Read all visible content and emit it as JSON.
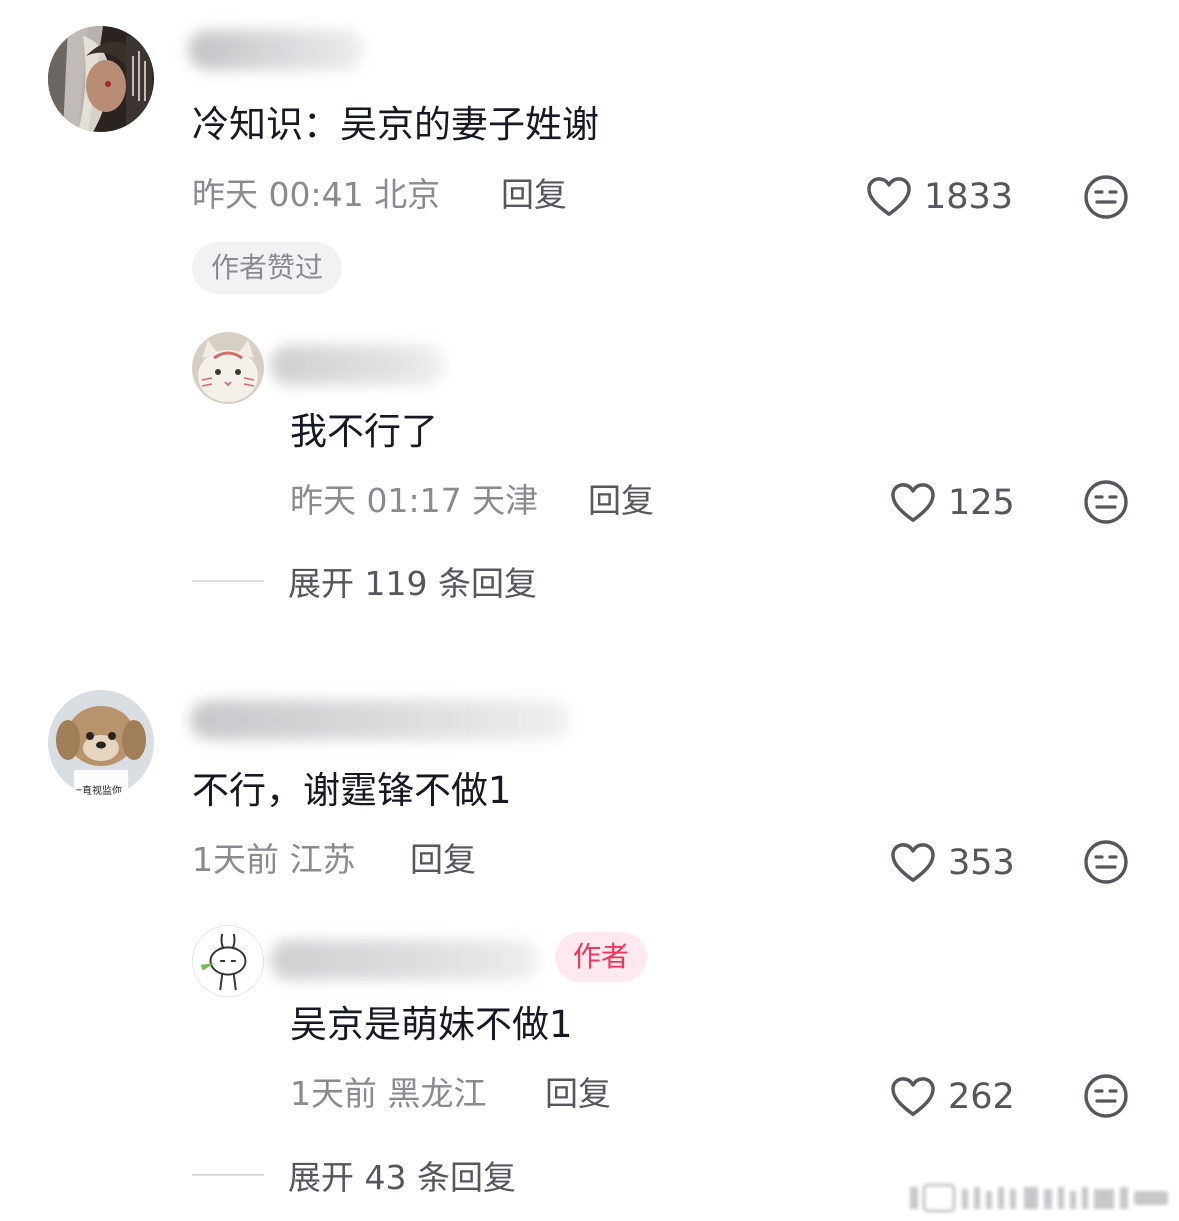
{
  "comments": [
    {
      "text": "冷知识：吴京的妻子姓谢",
      "time": "昨天 00:41",
      "location": "北京",
      "reply_label": "回复",
      "likes": "1833",
      "badge": "作者赞过",
      "avatar_icon": "dark-haired-character-avatar",
      "replies": [
        {
          "text": "我不行了",
          "time": "昨天 01:17",
          "location": "天津",
          "reply_label": "回复",
          "likes": "125",
          "avatar_icon": "white-cat-avatar"
        }
      ],
      "expand_label": "展开 119 条回复"
    },
    {
      "text": "不行，谢霆锋不做1",
      "time": "1天前",
      "location": "江苏",
      "reply_label": "回复",
      "likes": "353",
      "avatar_icon": "plush-puppy-avatar",
      "avatar_caption": "一直视监你",
      "replies": [
        {
          "text": "吴京是萌妹不做1",
          "time": "1天前",
          "location": "黑龙江",
          "reply_label": "回复",
          "likes": "262",
          "author_badge": "作者",
          "avatar_icon": "cartoon-bunny-avatar"
        }
      ],
      "expand_label": "展开 43 条回复"
    }
  ],
  "colors": {
    "text_primary": "#161823",
    "text_secondary": "#8a8b91",
    "author_badge_text": "#f2355a",
    "author_badge_bg": "#fde9ee",
    "liked_badge_bg": "#f2f2f4"
  }
}
